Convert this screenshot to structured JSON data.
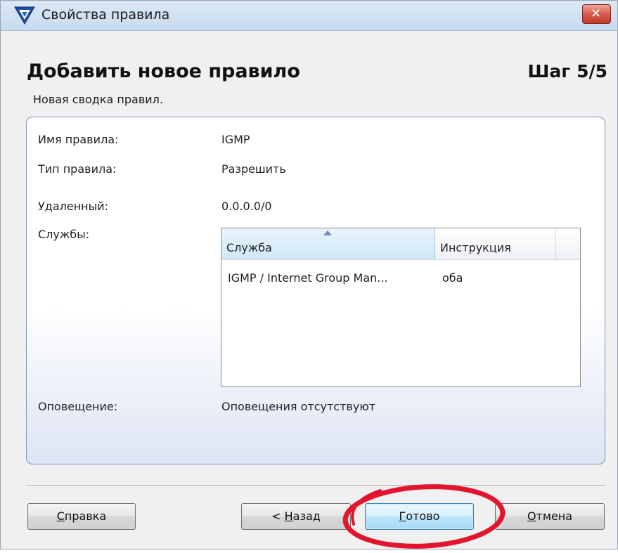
{
  "window": {
    "title": "Свойства правила",
    "close_symbol": "✕",
    "icon": "firewall-shield-icon"
  },
  "header": {
    "title": "Добавить новое правило",
    "step": "Шаг 5/5",
    "subtitle": "Новая сводка правил."
  },
  "summary": {
    "rule_name": {
      "label": "Имя правила:",
      "value": "IGMP"
    },
    "rule_type": {
      "label": "Тип правила:",
      "value": "Разрешить"
    },
    "remote": {
      "label": "Удаленный:",
      "value": "0.0.0.0/0"
    },
    "services": {
      "label": "Службы:",
      "columns": [
        "Служба",
        "Инструкция"
      ],
      "sort_column": "Служба",
      "rows": [
        {
          "service": "IGMP / Internet Group Man...",
          "direction": "оба"
        }
      ]
    },
    "notification": {
      "label": "Оповещение:",
      "value": "Оповещения отсутствуют"
    }
  },
  "buttons": {
    "help": {
      "mnemonic": "С",
      "rest": "правка"
    },
    "back": {
      "prefix": "< ",
      "mnemonic": "Н",
      "rest": "азад"
    },
    "finish": {
      "mnemonic": "Г",
      "rest": "отово"
    },
    "cancel": {
      "mnemonic": "О",
      "rest": "тмена"
    }
  },
  "colors": {
    "annotation_circle": "#e3142e",
    "default_button_border": "#3c7fb1",
    "panel_border": "#8095bb",
    "close_button": "#d85a4b"
  }
}
